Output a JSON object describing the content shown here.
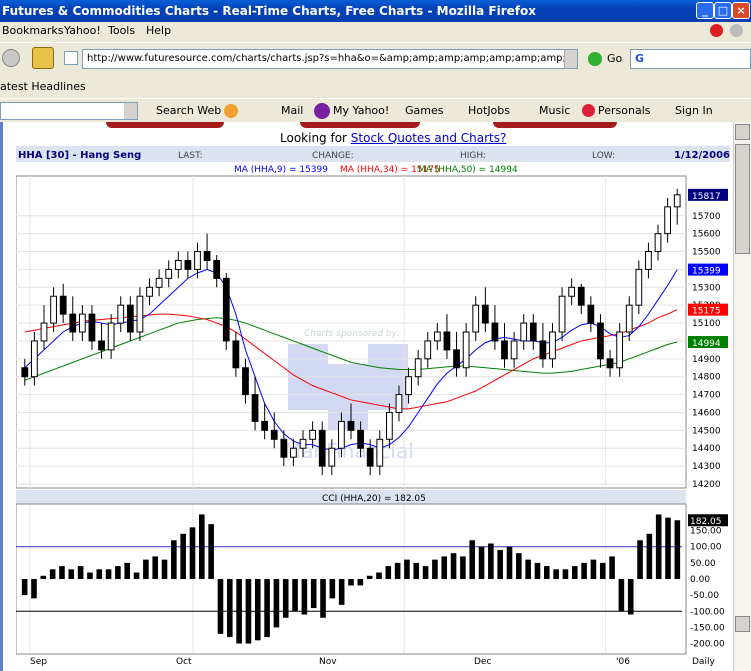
{
  "window": {
    "title": "Futures & Commodities Charts - Real-Time Charts, Free Charts - Mozilla Firefox",
    "min_label": "_",
    "max_label": "□",
    "close_label": "×"
  },
  "menu": {
    "items": [
      "Bookmarks",
      "Yahoo!",
      "Tools",
      "Help"
    ]
  },
  "nav": {
    "url": "http://www.futuresource.com/charts/charts.jsp?s=hha&o=&amp;amp;amp;amp;amp;amp;amp;amp;a=D",
    "go_label": "Go",
    "search_letter": "G"
  },
  "headlines": {
    "label": "atest Headlines"
  },
  "yahoo": {
    "items": [
      "Search Web",
      "Mail",
      "My Yahoo!",
      "Games",
      "HotJobs",
      "Music",
      "Personals",
      "Sign In"
    ]
  },
  "page": {
    "looking_for": "Looking for ",
    "link": "Stock Quotes and Charts?"
  },
  "chart_header": {
    "title": "HHA [30] - Hang Seng",
    "last": "LAST:",
    "change": "CHANGE:",
    "high": "HIGH:",
    "low": "LOW:",
    "date": "1/12/2006",
    "ma9": "MA (HHA,9) = 15399",
    "ma34": "MA (HHA,34) = 15175",
    "ma50": "MA (HHA,50) = 14994",
    "cci_label": "CCI (HHA,20) = 182.05",
    "sponsor": "Charts sponsored by:",
    "sponsor_brand": "ManFinancial"
  },
  "colors": {
    "ma9": "#0000ff",
    "ma34": "#ff0000",
    "ma50": "#008000",
    "last_badge": "#000080",
    "ma9_badge": "#0000ff",
    "ma34_badge": "#ff0000",
    "ma50_badge": "#008000",
    "cci_badge": "#000000"
  },
  "chart_data": [
    {
      "type": "candlestick",
      "title": "HHA [30] - Hang Seng",
      "x_labels": [
        "Sep",
        "Oct",
        "Nov",
        "Dec",
        "'06",
        "Daily"
      ],
      "ylim": [
        14200,
        15900
      ],
      "y_ticks": [
        14200,
        14300,
        14400,
        14500,
        14600,
        14700,
        14800,
        14900,
        15000,
        15100,
        15200,
        15300,
        15400,
        15500,
        15600,
        15700
      ],
      "badges": {
        "last": 15817,
        "ma9": 15399,
        "ma34": 15175,
        "ma50": 14994
      },
      "ohlc": [
        [
          14850,
          14900,
          14750,
          14800
        ],
        [
          14800,
          15050,
          14750,
          15000
        ],
        [
          15000,
          15200,
          14950,
          15100
        ],
        [
          15100,
          15300,
          15050,
          15250
        ],
        [
          15250,
          15320,
          15100,
          15150
        ],
        [
          15150,
          15250,
          15000,
          15050
        ],
        [
          15050,
          15200,
          15000,
          15150
        ],
        [
          15150,
          15200,
          14950,
          15000
        ],
        [
          15000,
          15100,
          14900,
          14950
        ],
        [
          14950,
          15150,
          14900,
          15100
        ],
        [
          15100,
          15250,
          15050,
          15200
        ],
        [
          15200,
          15250,
          15000,
          15050
        ],
        [
          15050,
          15300,
          15000,
          15250
        ],
        [
          15250,
          15350,
          15200,
          15300
        ],
        [
          15300,
          15400,
          15250,
          15350
        ],
        [
          15350,
          15450,
          15300,
          15400
        ],
        [
          15400,
          15500,
          15350,
          15450
        ],
        [
          15450,
          15500,
          15350,
          15400
        ],
        [
          15400,
          15550,
          15350,
          15500
        ],
        [
          15500,
          15600,
          15400,
          15450
        ],
        [
          15450,
          15480,
          15300,
          15350
        ],
        [
          15350,
          15380,
          14950,
          15000
        ],
        [
          15000,
          15050,
          14800,
          14850
        ],
        [
          14850,
          14900,
          14650,
          14700
        ],
        [
          14700,
          14800,
          14500,
          14550
        ],
        [
          14550,
          14650,
          14450,
          14500
        ],
        [
          14500,
          14600,
          14400,
          14450
        ],
        [
          14450,
          14500,
          14300,
          14350
        ],
        [
          14350,
          14450,
          14300,
          14400
        ],
        [
          14400,
          14500,
          14350,
          14450
        ],
        [
          14450,
          14550,
          14400,
          14500
        ],
        [
          14500,
          14550,
          14250,
          14300
        ],
        [
          14300,
          14450,
          14250,
          14400
        ],
        [
          14400,
          14600,
          14350,
          14550
        ],
        [
          14550,
          14650,
          14450,
          14500
        ],
        [
          14500,
          14550,
          14350,
          14400
        ],
        [
          14400,
          14450,
          14250,
          14300
        ],
        [
          14300,
          14500,
          14250,
          14450
        ],
        [
          14450,
          14650,
          14400,
          14600
        ],
        [
          14600,
          14750,
          14550,
          14700
        ],
        [
          14700,
          14850,
          14650,
          14800
        ],
        [
          14800,
          14950,
          14750,
          14900
        ],
        [
          14900,
          15050,
          14850,
          15000
        ],
        [
          15000,
          15100,
          14950,
          15050
        ],
        [
          15050,
          15150,
          14900,
          14950
        ],
        [
          14950,
          15050,
          14800,
          14850
        ],
        [
          14850,
          15100,
          14800,
          15050
        ],
        [
          15050,
          15250,
          15000,
          15200
        ],
        [
          15200,
          15300,
          15050,
          15100
        ],
        [
          15100,
          15200,
          14950,
          15000
        ],
        [
          15000,
          15100,
          14850,
          14900
        ],
        [
          14900,
          15050,
          14850,
          15000
        ],
        [
          15000,
          15150,
          14950,
          15100
        ],
        [
          15100,
          15150,
          14950,
          15000
        ],
        [
          15000,
          15100,
          14850,
          14900
        ],
        [
          14900,
          15100,
          14850,
          15050
        ],
        [
          15050,
          15300,
          15000,
          15250
        ],
        [
          15250,
          15350,
          15200,
          15300
        ],
        [
          15300,
          15320,
          15150,
          15200
        ],
        [
          15200,
          15250,
          15050,
          15100
        ],
        [
          15100,
          15150,
          14850,
          14900
        ],
        [
          14900,
          14950,
          14800,
          14850
        ],
        [
          14850,
          15100,
          14800,
          15050
        ],
        [
          15050,
          15250,
          15000,
          15200
        ],
        [
          15200,
          15450,
          15150,
          15400
        ],
        [
          15400,
          15550,
          15350,
          15500
        ],
        [
          15500,
          15650,
          15450,
          15600
        ],
        [
          15600,
          15800,
          15550,
          15750
        ],
        [
          15750,
          15850,
          15650,
          15817
        ]
      ],
      "ma9": [
        14850,
        14900,
        14950,
        15000,
        15050,
        15080,
        15100,
        15110,
        15100,
        15090,
        15100,
        15110,
        15120,
        15150,
        15200,
        15250,
        15300,
        15350,
        15380,
        15400,
        15380,
        15300,
        15150,
        14950,
        14800,
        14650,
        14550,
        14480,
        14440,
        14420,
        14420,
        14400,
        14390,
        14400,
        14420,
        14430,
        14420,
        14400,
        14420,
        14460,
        14520,
        14600,
        14680,
        14760,
        14820,
        14860,
        14900,
        14950,
        14990,
        15010,
        15020,
        15010,
        15000,
        15000,
        14990,
        14990,
        15020,
        15060,
        15090,
        15100,
        15080,
        15040,
        15020,
        15030,
        15080,
        15150,
        15230,
        15310,
        15399
      ],
      "ma34": [
        15050,
        15060,
        15070,
        15080,
        15090,
        15100,
        15110,
        15115,
        15120,
        15125,
        15130,
        15135,
        15140,
        15145,
        15150,
        15150,
        15145,
        15140,
        15130,
        15120,
        15100,
        15080,
        15050,
        15010,
        14970,
        14930,
        14890,
        14850,
        14810,
        14780,
        14750,
        14730,
        14710,
        14690,
        14670,
        14660,
        14650,
        14640,
        14630,
        14620,
        14620,
        14630,
        14640,
        14650,
        14660,
        14680,
        14700,
        14720,
        14750,
        14780,
        14810,
        14840,
        14870,
        14900,
        14920,
        14940,
        14960,
        14980,
        15000,
        15010,
        15020,
        15030,
        15040,
        15060,
        15080,
        15100,
        15130,
        15150,
        15175
      ],
      "ma50": [
        14780,
        14800,
        14820,
        14840,
        14860,
        14880,
        14900,
        14920,
        14940,
        14960,
        14980,
        15000,
        15020,
        15040,
        15060,
        15080,
        15100,
        15110,
        15120,
        15125,
        15130,
        15125,
        15115,
        15100,
        15080,
        15060,
        15040,
        15020,
        15000,
        14980,
        14960,
        14940,
        14920,
        14900,
        14880,
        14870,
        14860,
        14850,
        14845,
        14840,
        14840,
        14840,
        14845,
        14850,
        14855,
        14860,
        14860,
        14855,
        14850,
        14845,
        14840,
        14835,
        14830,
        14825,
        14820,
        14820,
        14825,
        14830,
        14840,
        14850,
        14860,
        14870,
        14880,
        14900,
        14920,
        14940,
        14960,
        14980,
        14994
      ]
    },
    {
      "type": "bar",
      "title": "CCI (HHA,20) = 182.05",
      "ylim": [
        -220,
        220
      ],
      "y_ticks": [
        -200,
        -150,
        -100,
        -50,
        0,
        50,
        100,
        150
      ],
      "reference_lines": [
        100,
        -100
      ],
      "badge": 182.05,
      "values": [
        -50,
        -60,
        10,
        30,
        40,
        30,
        40,
        20,
        30,
        30,
        40,
        50,
        20,
        60,
        70,
        60,
        120,
        140,
        160,
        200,
        170,
        -170,
        -180,
        -200,
        -200,
        -190,
        -180,
        -150,
        -120,
        -100,
        -110,
        -90,
        -120,
        -60,
        -80,
        -20,
        -20,
        10,
        20,
        40,
        50,
        60,
        50,
        40,
        60,
        70,
        80,
        70,
        120,
        100,
        110,
        90,
        100,
        80,
        60,
        50,
        40,
        30,
        30,
        40,
        50,
        60,
        50,
        70,
        -100,
        -110,
        120,
        140,
        200,
        190,
        182
      ]
    }
  ]
}
